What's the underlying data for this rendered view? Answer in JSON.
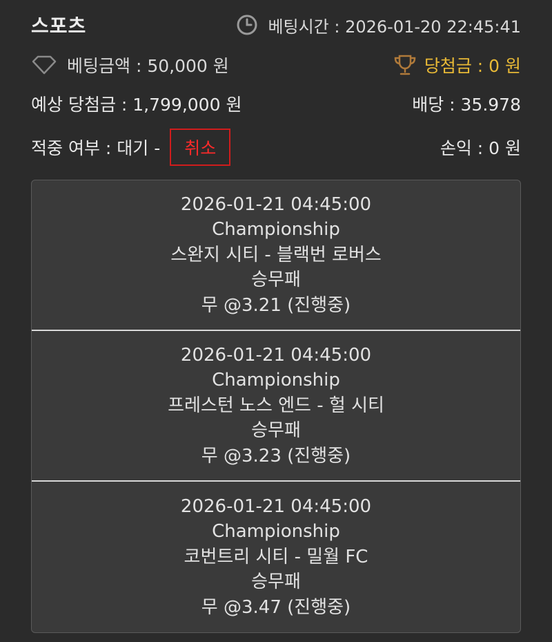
{
  "header": {
    "title": "스포츠",
    "bet_time": "베팅시간 : 2026-01-20 22:45:41"
  },
  "summary": {
    "bet_amount": "베팅금액 : 50,000 원",
    "winnings": "당첨금 : 0 원",
    "expected_winnings": "예상 당첨금 : 1,799,000 원",
    "odds": "배당 : 35.978",
    "hit_status": "적중 여부 : 대기 -",
    "cancel_label": "취소",
    "profit_loss": "손익 : 0 원"
  },
  "colors": {
    "background": "#2b2b2b",
    "card": "#3a3a3a",
    "gold": "#e8b936",
    "cancel_red": "#ff2a2a"
  },
  "icons": {
    "bet_time": "clock-icon",
    "bet_amount": "diamond-icon",
    "winnings": "trophy-icon"
  },
  "matches": [
    {
      "datetime": "2026-01-21 04:45:00",
      "league": "Championship",
      "teams": "스완지 시티 - 블랙번 로버스",
      "market": "승무패",
      "pick": "무 @3.21 (진행중)"
    },
    {
      "datetime": "2026-01-21 04:45:00",
      "league": "Championship",
      "teams": "프레스턴 노스 엔드 - 헐 시티",
      "market": "승무패",
      "pick": "무 @3.23 (진행중)"
    },
    {
      "datetime": "2026-01-21 04:45:00",
      "league": "Championship",
      "teams": "코번트리 시티 - 밀월 FC",
      "market": "승무패",
      "pick": "무 @3.47 (진행중)"
    }
  ]
}
